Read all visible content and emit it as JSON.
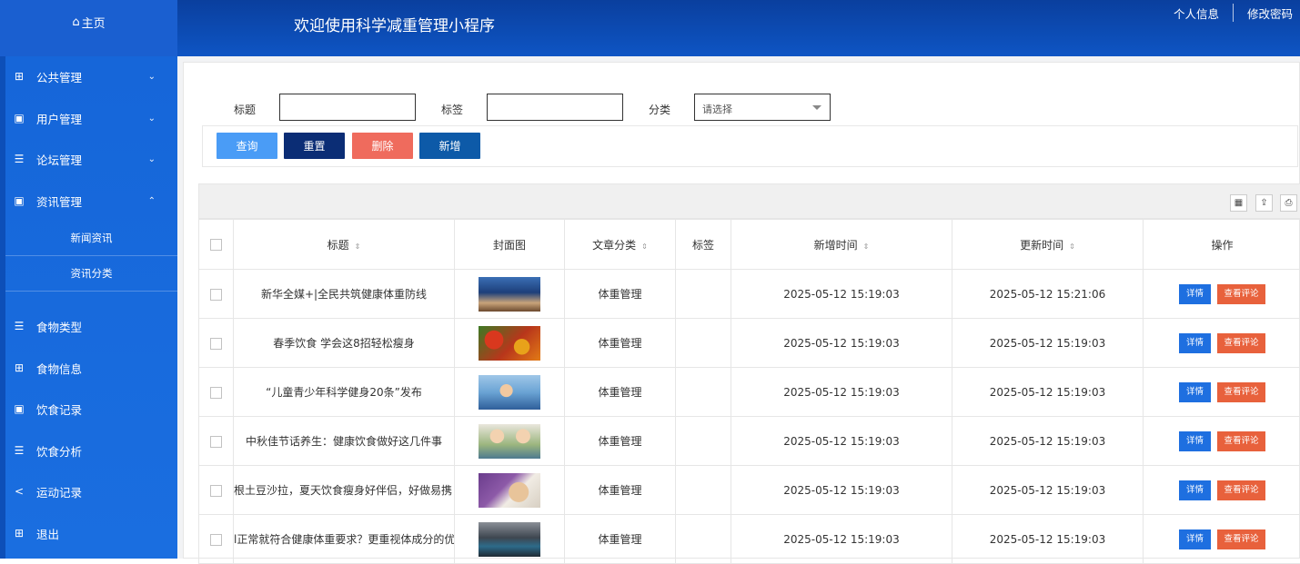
{
  "sidebar": {
    "home": "主页",
    "menus": [
      {
        "label": "公共管理",
        "icon": "grid-icon",
        "chevron": "⌄"
      },
      {
        "label": "用户管理",
        "icon": "book-icon",
        "chevron": "⌄"
      },
      {
        "label": "论坛管理",
        "icon": "list-icon",
        "chevron": "⌄"
      },
      {
        "label": "资讯管理",
        "icon": "book-icon",
        "chevron": "⌃"
      }
    ],
    "submenus": [
      "新闻资讯",
      "资讯分类"
    ],
    "menus2": [
      {
        "label": "食物类型",
        "icon": "list-icon"
      },
      {
        "label": "食物信息",
        "icon": "grid-icon"
      },
      {
        "label": "饮食记录",
        "icon": "book-icon"
      },
      {
        "label": "饮食分析",
        "icon": "list-icon"
      },
      {
        "label": "运动记录",
        "icon": "share-icon"
      },
      {
        "label": "退出",
        "icon": "grid-icon"
      }
    ]
  },
  "header": {
    "title": "欢迎使用科学减重管理小程序",
    "links": [
      "个人信息",
      "修改密码"
    ]
  },
  "search": {
    "title_label": "标题",
    "tag_label": "标签",
    "category_label": "分类",
    "category_placeholder": "请选择"
  },
  "buttons": {
    "query": "查询",
    "reset": "重置",
    "delete": "删除",
    "add": "新增"
  },
  "colors": {
    "query": "#4a9cf6",
    "reset": "#0b2d75",
    "delete": "#ef6b5d",
    "add": "#0d5aa8"
  },
  "table": {
    "headers": [
      "标题",
      "封面图",
      "文章分类",
      "标签",
      "新增时间",
      "更新时间",
      "操作"
    ],
    "rows": [
      {
        "title": "新华全媒+|全民共筑健康体重防线",
        "category": "体重管理",
        "tag": "",
        "created": "2025-05-12 15:19:03",
        "updated": "2025-05-12 15:21:06"
      },
      {
        "title": "春季饮食 学会这8招轻松瘦身",
        "category": "体重管理",
        "tag": "",
        "created": "2025-05-12 15:19:03",
        "updated": "2025-05-12 15:19:03"
      },
      {
        "title": "“儿童青少年科学健身20条”发布",
        "category": "体重管理",
        "tag": "",
        "created": "2025-05-12 15:19:03",
        "updated": "2025-05-12 15:19:03"
      },
      {
        "title": "中秋佳节话养生：健康饮食做好这几件事",
        "category": "体重管理",
        "tag": "",
        "created": "2025-05-12 15:19:03",
        "updated": "2025-05-12 15:19:03"
      },
      {
        "title": "根土豆沙拉，夏天饮食瘦身好伴侣，好做易携",
        "category": "体重管理",
        "tag": "",
        "created": "2025-05-12 15:19:03",
        "updated": "2025-05-12 15:19:03"
      },
      {
        "title": "l正常就符合健康体重要求？更重视体成分的优",
        "category": "体重管理",
        "tag": "",
        "created": "2025-05-12 15:19:03",
        "updated": "2025-05-12 15:19:03"
      }
    ],
    "action_detail": "详情",
    "action_comment": "查看评论"
  }
}
